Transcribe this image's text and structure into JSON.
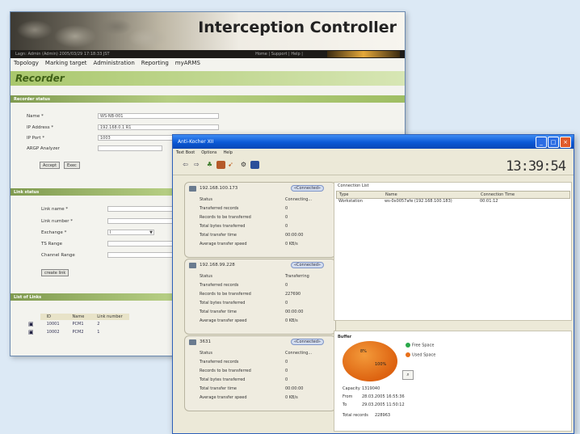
{
  "back_window": {
    "app_title": "Interception Controller",
    "status_left": "Lagn: Admin (Admin)  2005/03/29 17:18:33 JST",
    "status_right": "Home | Support | Help |",
    "menu": [
      "Topology",
      "Marking target",
      "Administration",
      "Reporting",
      "myARMS"
    ],
    "page_title": "Recorder",
    "sections": {
      "recorder_status": "Recorder status",
      "link_status": "Link status",
      "list_of_links": "List of Links"
    },
    "recorder_fields": [
      {
        "label": "Name *",
        "value": "WS-NB-001"
      },
      {
        "label": "IP Address *",
        "value": "192.168.0.1 R1"
      },
      {
        "label": "IP Port *",
        "value": "1003"
      },
      {
        "label": "ARGP Analyzer",
        "value": ""
      }
    ],
    "recorder_buttons": [
      "Accept",
      "Exec"
    ],
    "link_fields": [
      "Link name *",
      "Link number *",
      "Exchange *",
      "TS Range",
      "Channel Range"
    ],
    "exchange_value": "I",
    "create_link_label": "create link",
    "links_table": {
      "headers": [
        "ID",
        "Name",
        "Link number"
      ],
      "rows": [
        {
          "id": "10001",
          "name": "PCM1",
          "number": "2"
        },
        {
          "id": "10002",
          "name": "PCM2",
          "number": "1"
        }
      ]
    }
  },
  "front_window": {
    "title": "Anti-Kocher XII",
    "menu": [
      "Text Boot",
      "Options",
      "Help"
    ],
    "clock": "13:39:54",
    "cards": [
      {
        "ip": "192.168.100.173",
        "status_badge": "«Connected»",
        "rows": [
          {
            "label": "Status",
            "value": "Connecting..."
          },
          {
            "label": "Transferred records",
            "value": "0"
          },
          {
            "label": "Records to be transferred",
            "value": "0"
          },
          {
            "label": "Total bytes transferred",
            "value": "0"
          },
          {
            "label": "Total transfer time",
            "value": "00:00:00"
          },
          {
            "label": "Average transfer speed",
            "value": "0 KB/s"
          }
        ]
      },
      {
        "ip": "192.168.99.228",
        "status_badge": "«Connected»",
        "rows": [
          {
            "label": "Status",
            "value": "Transferring"
          },
          {
            "label": "Transferred records",
            "value": "0"
          },
          {
            "label": "Records to be transferred",
            "value": "227690"
          },
          {
            "label": "Total bytes transferred",
            "value": "0"
          },
          {
            "label": "Total transfer time",
            "value": "00:00:00"
          },
          {
            "label": "Average transfer speed",
            "value": "0 KB/s"
          }
        ]
      },
      {
        "ip": "3631",
        "status_badge": "«Connected»",
        "rows": [
          {
            "label": "Status",
            "value": "Connecting..."
          },
          {
            "label": "Transferred records",
            "value": "0"
          },
          {
            "label": "Records to be transferred",
            "value": "0"
          },
          {
            "label": "Total bytes transferred",
            "value": "0"
          },
          {
            "label": "Total transfer time",
            "value": "00:00:00"
          },
          {
            "label": "Average transfer speed",
            "value": "0 KB/s"
          }
        ]
      }
    ],
    "connection_list": {
      "label": "Connection List",
      "headers": [
        "Type",
        "Name",
        "Connection Time"
      ],
      "row": {
        "type": "Workstation",
        "name": "ws-0x0057afe (192.168.100.183)",
        "time": "00:01:12"
      }
    },
    "buffer": {
      "label": "Buffer",
      "pie_label_1": "8%",
      "pie_label_2": "100%",
      "legend": [
        {
          "label": "Free Space",
          "color": "#2aa84a"
        },
        {
          "label": "Used Space",
          "color": "#e8701a"
        }
      ],
      "info": [
        {
          "label": "Capacity",
          "value": "1319040"
        },
        {
          "label": "From",
          "value": "28.03.2005 16:55:36"
        },
        {
          "label": "To",
          "value": "29.03.2005 11:50:12"
        },
        {
          "label": "Total records",
          "value": "228963"
        }
      ]
    }
  }
}
